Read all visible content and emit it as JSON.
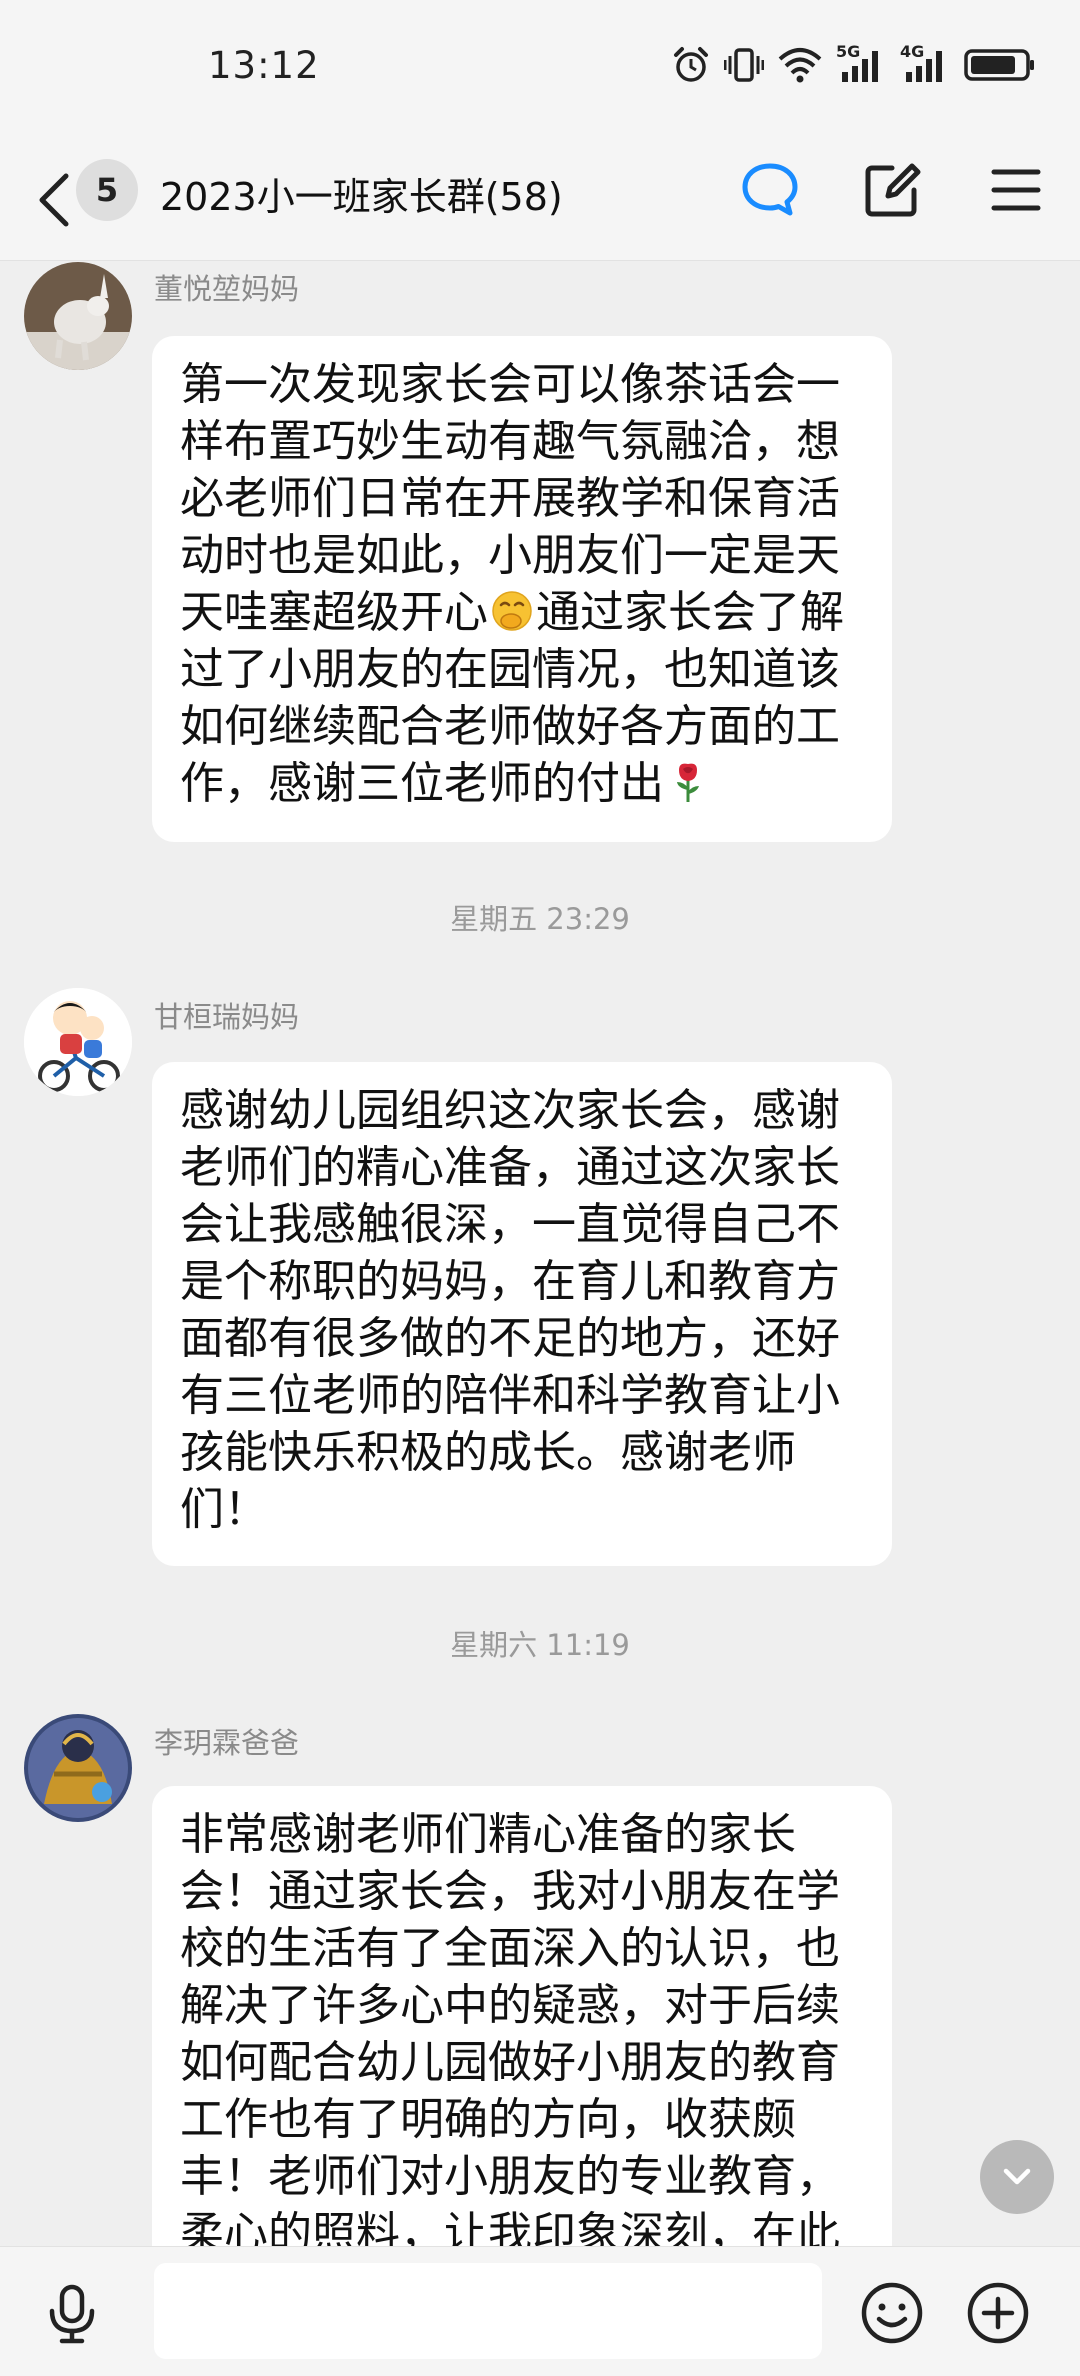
{
  "status_bar": {
    "time": "13:12",
    "network_labels": [
      "5G",
      "4G"
    ]
  },
  "header": {
    "unread_count": "5",
    "title": "2023小一班家长群(58)"
  },
  "messages": [
    {
      "sender": "董悦堃妈妈",
      "text_before_emoji": "第一次发现家长会可以像茶话会一样布置巧妙生动有趣气氛融洽，想必老师们日常在开展教学和保育活动时也是如此，小朋友们一定是天天哇塞超级开心",
      "emoji_1": "face-with-hand-over-mouth-emoji",
      "text_after_emoji": "通过家长会了解过了小朋友的在园情况，也知道该如何继续配合老师做好各方面的工作，感谢三位老师的付出",
      "emoji_2": "rose-emoji"
    },
    {
      "timestamp": "星期五 23:29",
      "sender": "甘桓瑞妈妈",
      "text": "感谢幼儿园组织这次家长会，感谢老师们的精心准备，通过这次家长会让我感触很深，一直觉得自己不是个称职的妈妈，在育儿和教育方面都有很多做的不足的地方，还好有三位老师的陪伴和科学教育让小孩能快乐积极的成长。感谢老师们！"
    },
    {
      "timestamp": "星期六 11:19",
      "sender": "李玥霖爸爸",
      "text": "非常感谢老师们精心准备的家长会！通过家长会，我对小朋友在学校的生活有了全面深入的认识，也解决了许多心中的疑惑，对于后续如何配合幼儿园做好小朋友的教育工作也有了明确的方向，收获颇丰！老师们对小朋友的专业教育，柔心的照料，让我印象深刻，在此"
    }
  ],
  "input_bar": {
    "value": "",
    "placeholder": ""
  },
  "colors": {
    "background": "#efefef",
    "bubble": "#ffffff",
    "accent_blue": "#1a8cff",
    "secondary_text": "#8a8a8a"
  }
}
